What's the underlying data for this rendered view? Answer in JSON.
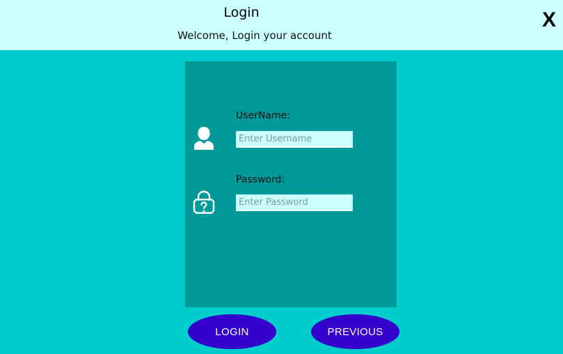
{
  "header": {
    "title": "Login",
    "subtitle": "Welcome, Login your account",
    "close_label": "X"
  },
  "form": {
    "username_label": "UserName:",
    "username_placeholder": "Enter Username",
    "username_value": "",
    "password_label": "Password:",
    "password_placeholder": "Enter Password",
    "password_value": "",
    "username_icon": "user-icon",
    "password_icon": "lock-question-icon"
  },
  "buttons": {
    "login_label": "LOGIN",
    "previous_label": "PREVIOUS"
  },
  "colors": {
    "background": "#00cccc",
    "header": "#ccffff",
    "panel": "#009999",
    "button": "#3300cc"
  }
}
